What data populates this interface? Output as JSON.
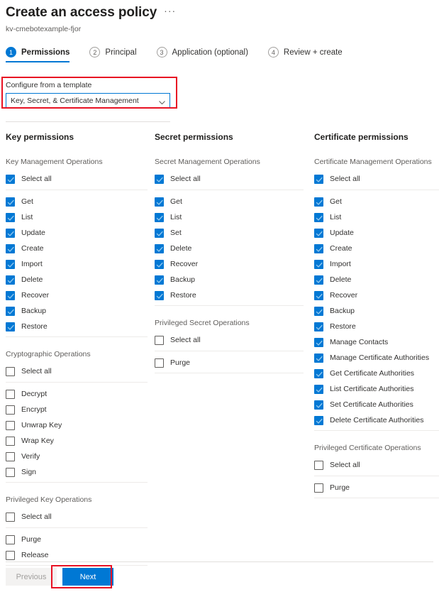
{
  "header": {
    "title": "Create an access policy",
    "more_menu": "···",
    "subtitle": "kv-cmebotexample-fjor"
  },
  "tabs": [
    {
      "num": "1",
      "label": "Permissions",
      "active": true
    },
    {
      "num": "2",
      "label": "Principal",
      "active": false
    },
    {
      "num": "3",
      "label": "Application (optional)",
      "active": false
    },
    {
      "num": "4",
      "label": "Review + create",
      "active": false
    }
  ],
  "template": {
    "label": "Configure from a template",
    "selected": "Key, Secret, & Certificate Management"
  },
  "columns": [
    {
      "title": "Key permissions",
      "groups": [
        {
          "title": "Key Management Operations",
          "select_all": {
            "label": "Select all",
            "checked": true
          },
          "items": [
            {
              "label": "Get",
              "checked": true
            },
            {
              "label": "List",
              "checked": true
            },
            {
              "label": "Update",
              "checked": true
            },
            {
              "label": "Create",
              "checked": true
            },
            {
              "label": "Import",
              "checked": true
            },
            {
              "label": "Delete",
              "checked": true
            },
            {
              "label": "Recover",
              "checked": true
            },
            {
              "label": "Backup",
              "checked": true
            },
            {
              "label": "Restore",
              "checked": true
            }
          ]
        },
        {
          "title": "Cryptographic Operations",
          "select_all": {
            "label": "Select all",
            "checked": false
          },
          "items": [
            {
              "label": "Decrypt",
              "checked": false
            },
            {
              "label": "Encrypt",
              "checked": false
            },
            {
              "label": "Unwrap Key",
              "checked": false
            },
            {
              "label": "Wrap Key",
              "checked": false
            },
            {
              "label": "Verify",
              "checked": false
            },
            {
              "label": "Sign",
              "checked": false
            }
          ]
        },
        {
          "title": "Privileged Key Operations",
          "select_all": {
            "label": "Select all",
            "checked": false
          },
          "items": [
            {
              "label": "Purge",
              "checked": false
            },
            {
              "label": "Release",
              "checked": false
            }
          ]
        }
      ]
    },
    {
      "title": "Secret permissions",
      "groups": [
        {
          "title": "Secret Management Operations",
          "select_all": {
            "label": "Select all",
            "checked": true
          },
          "items": [
            {
              "label": "Get",
              "checked": true
            },
            {
              "label": "List",
              "checked": true
            },
            {
              "label": "Set",
              "checked": true
            },
            {
              "label": "Delete",
              "checked": true
            },
            {
              "label": "Recover",
              "checked": true
            },
            {
              "label": "Backup",
              "checked": true
            },
            {
              "label": "Restore",
              "checked": true
            }
          ]
        },
        {
          "title": "Privileged Secret Operations",
          "select_all": {
            "label": "Select all",
            "checked": false
          },
          "items": [
            {
              "label": "Purge",
              "checked": false
            }
          ]
        }
      ]
    },
    {
      "title": "Certificate permissions",
      "groups": [
        {
          "title": "Certificate Management Operations",
          "select_all": {
            "label": "Select all",
            "checked": true
          },
          "items": [
            {
              "label": "Get",
              "checked": true
            },
            {
              "label": "List",
              "checked": true
            },
            {
              "label": "Update",
              "checked": true
            },
            {
              "label": "Create",
              "checked": true
            },
            {
              "label": "Import",
              "checked": true
            },
            {
              "label": "Delete",
              "checked": true
            },
            {
              "label": "Recover",
              "checked": true
            },
            {
              "label": "Backup",
              "checked": true
            },
            {
              "label": "Restore",
              "checked": true
            },
            {
              "label": "Manage Contacts",
              "checked": true
            },
            {
              "label": "Manage Certificate Authorities",
              "checked": true
            },
            {
              "label": "Get Certificate Authorities",
              "checked": true
            },
            {
              "label": "List Certificate Authorities",
              "checked": true
            },
            {
              "label": "Set Certificate Authorities",
              "checked": true
            },
            {
              "label": "Delete Certificate Authorities",
              "checked": true
            }
          ]
        },
        {
          "title": "Privileged Certificate Operations",
          "select_all": {
            "label": "Select all",
            "checked": false
          },
          "items": [
            {
              "label": "Purge",
              "checked": false
            }
          ]
        }
      ]
    }
  ],
  "footer": {
    "previous_label": "Previous",
    "next_label": "Next"
  },
  "colors": {
    "accent": "#0078d4",
    "annotation": "#e81123",
    "text": "#323130",
    "muted": "#605e5c",
    "divider": "#e1dfdd"
  }
}
